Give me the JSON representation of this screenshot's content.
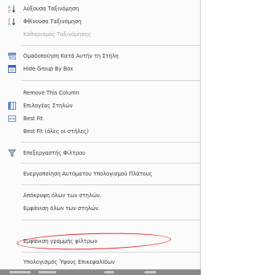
{
  "menu": {
    "items": [
      {
        "label": "Αύξουσα Ταξινόμηση",
        "icon": "sort-ascending-icon"
      },
      {
        "label": "Φθίνουσα Ταξινόμηση",
        "icon": "sort-descending-icon"
      },
      {
        "label": "Καθαρισμός Ταξινόμησης",
        "disabled": true
      },
      {
        "label": "Ομαδοποίηση Κατά Αυτήν τη Στήλη",
        "icon": "group-by-column-icon"
      },
      {
        "label": "Hide Group By Box",
        "icon": "group-box-icon"
      },
      {
        "label": "Remove This Column"
      },
      {
        "label": "Επιλογέας Στηλών",
        "icon": "column-chooser-icon"
      },
      {
        "label": "Best Fit",
        "icon": "best-fit-icon"
      },
      {
        "label": "Best Fit (όλες οι στήλες)"
      },
      {
        "label": "Επεξεργαστής Φίλτρου",
        "icon": "filter-icon"
      },
      {
        "label": "Ενεργοποίηση Αυτόματου Υπολογισμού Πλάτους"
      },
      {
        "label": "Απόκρυψη όλων των στηλών."
      },
      {
        "label": "Εμφάνιση όλων των στηλών."
      },
      {
        "label": "Εμφάνιση γραμμής φίλτρων"
      },
      {
        "label": "Υπολογισμός Ύψους Επικεφαλίδων"
      }
    ]
  },
  "colors": {
    "highlight": "#e22a2a",
    "background": "#fbfbfb"
  }
}
